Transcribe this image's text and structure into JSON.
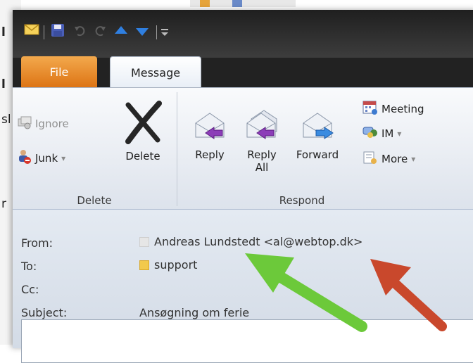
{
  "quick_access": {
    "icons": [
      "mail-icon",
      "save-icon",
      "undo-icon",
      "redo-icon",
      "previous-item-icon",
      "next-item-icon",
      "customize-toolbar-icon"
    ]
  },
  "tabs": [
    {
      "label": "File",
      "active": false
    },
    {
      "label": "Message",
      "active": true
    }
  ],
  "ribbon": {
    "delete_group": {
      "label": "Delete",
      "ignore": "Ignore",
      "junk": "Junk",
      "junk_arrow": "▾",
      "delete": "Delete"
    },
    "respond_group": {
      "label": "Respond",
      "reply": "Reply",
      "reply_all_line1": "Reply",
      "reply_all_line2": "All",
      "forward": "Forward",
      "meeting": "Meeting",
      "im": "IM",
      "im_arrow": "▾",
      "more": "More",
      "more_arrow": "▾"
    }
  },
  "header": {
    "from_label": "From:",
    "from_value": "Andreas Lundstedt <al@webtop.dk>",
    "to_label": "To:",
    "to_value": "support",
    "cc_label": "Cc:",
    "subject_label": "Subject:",
    "subject_value": "Ansøgning om ferie"
  },
  "colors": {
    "file_tab": "#e07a1b",
    "green_arrow": "#6cc93a",
    "red_arrow": "#c9482c",
    "to_square": "#f2c94c",
    "from_square": "#e6e6e6"
  }
}
